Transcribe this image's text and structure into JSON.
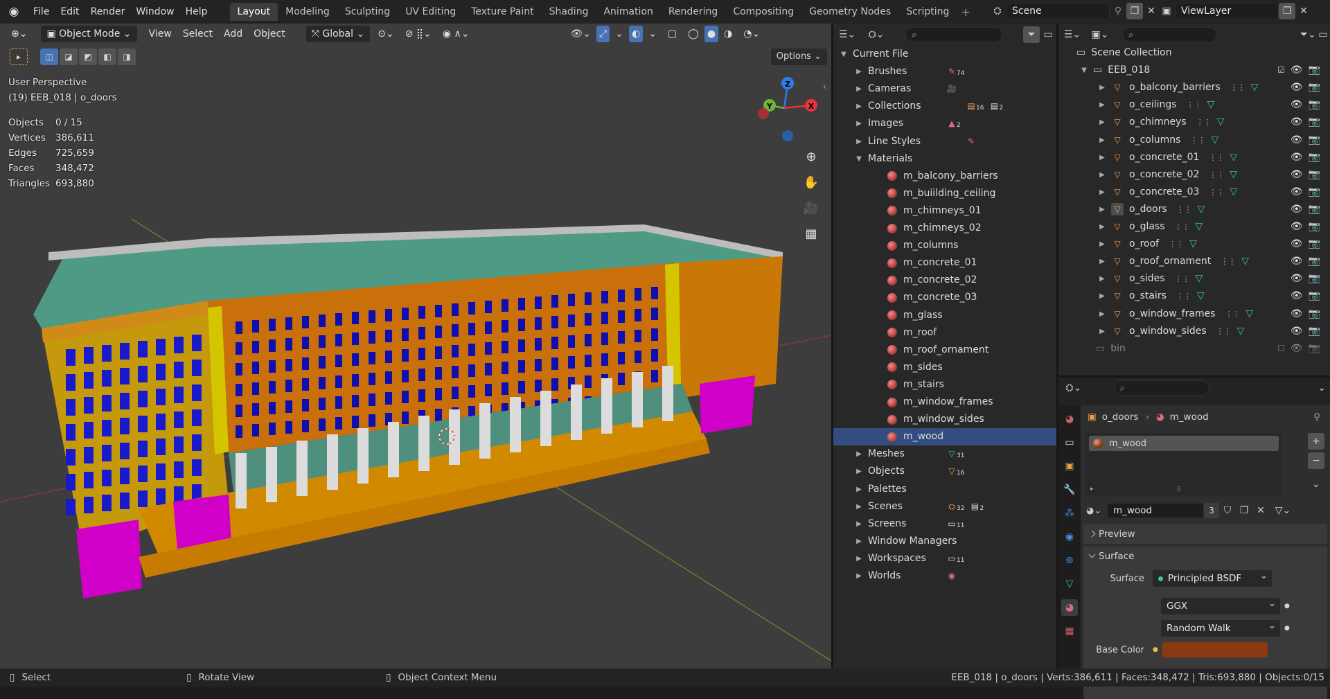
{
  "topbar": {
    "menus": [
      "File",
      "Edit",
      "Render",
      "Window",
      "Help"
    ],
    "workspaces": [
      "Layout",
      "Modeling",
      "Sculpting",
      "UV Editing",
      "Texture Paint",
      "Shading",
      "Animation",
      "Rendering",
      "Compositing",
      "Geometry Nodes",
      "Scripting"
    ],
    "active_workspace": "Layout",
    "scene": "Scene",
    "view_layer": "ViewLayer"
  },
  "viewport": {
    "mode": "Object Mode",
    "menus": [
      "View",
      "Select",
      "Add",
      "Object"
    ],
    "transform_orientation": "Global",
    "options_label": "Options",
    "perspective": "User Perspective",
    "context": "(19) EEB_018 | o_doors",
    "stats": [
      {
        "label": "Objects",
        "value": "0 / 15"
      },
      {
        "label": "Vertices",
        "value": "386,611"
      },
      {
        "label": "Edges",
        "value": "725,659"
      },
      {
        "label": "Faces",
        "value": "348,472"
      },
      {
        "label": "Triangles",
        "value": "693,880"
      }
    ],
    "gizmo": {
      "z": "Z",
      "y": "Y",
      "x": "X"
    }
  },
  "blend_outliner": {
    "root": "Current File",
    "items": [
      {
        "label": "Brushes",
        "count": "74",
        "icon": "brush-icon"
      },
      {
        "label": "Cameras",
        "count": "",
        "icon": "camera-data-icon"
      },
      {
        "label": "Collections",
        "count": "16",
        "count2": "2",
        "icon": "collection-icon"
      },
      {
        "label": "Images",
        "count": "2",
        "icon": "image-icon"
      },
      {
        "label": "Line Styles",
        "count": "",
        "icon": "linestyle-icon"
      },
      {
        "label": "Materials",
        "count": "",
        "icon": "",
        "expanded": true
      }
    ],
    "materials": [
      "m_balcony_barriers",
      "m_buiilding_ceiling",
      "m_chimneys_01",
      "m_chimneys_02",
      "m_columns",
      "m_concrete_01",
      "m_concrete_02",
      "m_concrete_03",
      "m_glass",
      "m_roof",
      "m_roof_ornament",
      "m_sides",
      "m_stairs",
      "m_window_frames",
      "m_window_sides",
      "m_wood"
    ],
    "selected_material": "m_wood",
    "items_after": [
      {
        "label": "Meshes",
        "count": "31",
        "icon": "mesh-icon"
      },
      {
        "label": "Objects",
        "count": "16",
        "icon": "object-icon"
      },
      {
        "label": "Palettes",
        "count": "",
        "icon": ""
      },
      {
        "label": "Scenes",
        "count": "32",
        "count2": "2",
        "icon": "scene-icon"
      },
      {
        "label": "Screens",
        "count": "11",
        "icon": "screen-icon"
      },
      {
        "label": "Window Managers",
        "count": "",
        "icon": ""
      },
      {
        "label": "Workspaces",
        "count": "11",
        "icon": "workspace-icon"
      },
      {
        "label": "Worlds",
        "count": "",
        "icon": "world-icon"
      }
    ]
  },
  "scene_outliner": {
    "root": "Scene Collection",
    "collection": "EEB_018",
    "objects": [
      "o_balcony_barriers",
      "o_ceilings",
      "o_chimneys",
      "o_columns",
      "o_concrete_01",
      "o_concrete_02",
      "o_concrete_03",
      "o_doors",
      "o_glass",
      "o_roof",
      "o_roof_ornament",
      "o_sides",
      "o_stairs",
      "o_window_frames",
      "o_window_sides"
    ],
    "bin": "bin"
  },
  "properties": {
    "breadcrumb_object": "o_doors",
    "breadcrumb_material": "m_wood",
    "slot": "m_wood",
    "material_name": "m_wood",
    "users": "3",
    "panels": {
      "preview": "Preview",
      "surface": "Surface"
    },
    "surface_label": "Surface",
    "surface_value": "Principled BSDF",
    "distribution": "GGX",
    "subsurface": "Random Walk",
    "base_color_label": "Base Color",
    "base_color": "#8a3a12"
  },
  "statusbar": {
    "select": "Select",
    "rotate": "Rotate View",
    "context_menu": "Object Context Menu",
    "info": "EEB_018 | o_doors | Verts:386,611 | Faces:348,472 | Tris:693,880 | Objects:0/15"
  }
}
